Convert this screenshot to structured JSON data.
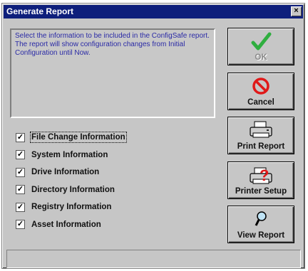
{
  "window": {
    "title": "Generate Report",
    "close_label": "×"
  },
  "info": {
    "text": "Select the information to be included in the ConfigSafe report.  The report will show configuration changes from Initial Configuration until Now."
  },
  "checkboxes": [
    {
      "label": "File Change Information",
      "checked": true,
      "mark": "✓"
    },
    {
      "label": "System Information",
      "checked": true,
      "mark": "✓"
    },
    {
      "label": "Drive Information",
      "checked": true,
      "mark": "✓"
    },
    {
      "label": "Directory Information",
      "checked": true,
      "mark": "✓"
    },
    {
      "label": "Registry Information",
      "checked": true,
      "mark": "✓"
    },
    {
      "label": "Asset Information",
      "checked": true,
      "mark": "✓"
    }
  ],
  "buttons": {
    "ok": {
      "label": "OK",
      "icon": "checkmark-icon",
      "enabled": false
    },
    "cancel": {
      "label": "Cancel",
      "icon": "no-symbol-icon"
    },
    "print_report": {
      "label": "Print Report",
      "icon": "printer-icon"
    },
    "printer_setup": {
      "label": "Printer Setup",
      "icon": "printer-question-icon"
    },
    "view_report": {
      "label": "View Report",
      "icon": "magnifier-icon"
    }
  },
  "colors": {
    "titlebar": "#0e1f7c",
    "info_text": "#2a2aa6",
    "check_green": "#2fae3f",
    "cancel_red": "#e01818"
  }
}
